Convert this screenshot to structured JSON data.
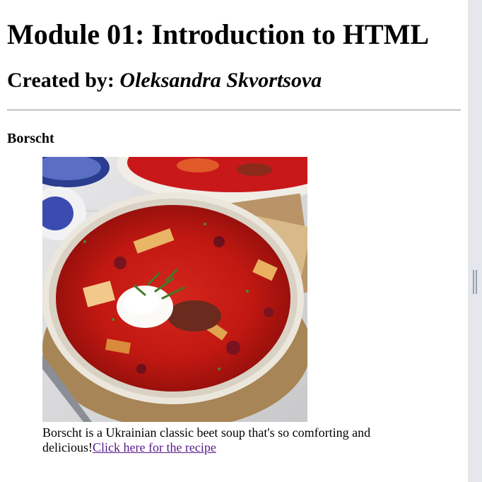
{
  "page": {
    "title": "Module 01: Introduction to HTML",
    "created_by_label": "Created by:",
    "author": "Oleksandra Skvortsova"
  },
  "recipe": {
    "heading": "Borscht",
    "image_alt": "Bowl of borscht with sour cream and dill",
    "caption_text": "Borscht is a Ukrainian classic beet soup that's so comforting and delicious!",
    "link_text": "Click here for the recipe"
  },
  "colors": {
    "link_visited": "#551a8b",
    "scrollbar_track": "#e5e7ed",
    "soup_red": "#c41a1a"
  },
  "icons": {
    "scroll_grip": "grip-icon"
  }
}
